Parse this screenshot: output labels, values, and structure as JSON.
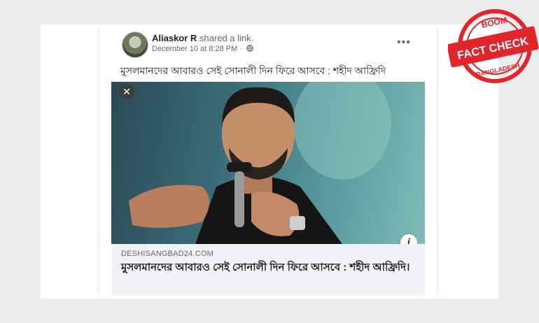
{
  "post": {
    "author": "Aliaskor R",
    "action": " shared a link.",
    "timestamp": "December 10 at 8:28 PM",
    "visibility_separator": " · ",
    "more_label": "•••",
    "text": "মুসলমানদের আবারও সেই সোনালী দিন ফিরে আসবে : শহীদ আফ্রিদি",
    "close_label": "✕",
    "info_label": "i"
  },
  "link": {
    "domain": "DESHISANGBAD24.COM",
    "title": "মুসলমানদের আবারও সেই সোনালী দিন ফিরে আসবে : শহীদ আফ্রিদি।"
  },
  "badge": {
    "top": "BOOM",
    "main": "FACT CHECK",
    "bottom": "BANGLADESH",
    "color": "#e0262b"
  }
}
